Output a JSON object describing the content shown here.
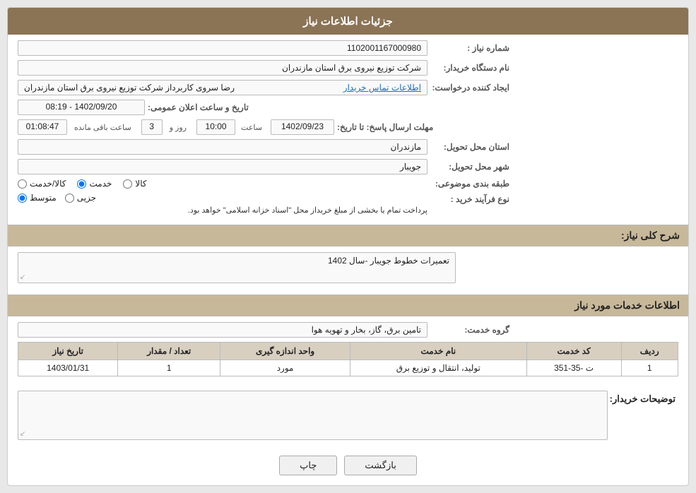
{
  "header": {
    "title": "جزئیات اطلاعات نیاز"
  },
  "fields": {
    "need_number_label": "شماره نیاز :",
    "need_number_value": "1102001167000980",
    "buyer_org_label": "نام دستگاه خریدار:",
    "buyer_org_value": "شرکت توزیع نیروی برق استان مازندران",
    "requester_label": "ایجاد کننده درخواست:",
    "requester_value": "رضا سروی کاربرداز شرکت توزیع نیروی برق استان مازندران",
    "contact_link": "اطلاعات تماس خریدار",
    "announce_label": "تاریخ و ساعت اعلان عمومی:",
    "announce_value": "1402/09/20 - 08:19",
    "deadline_label": "مهلت ارسال پاسخ: تا تاریخ:",
    "deadline_date": "1402/09/23",
    "deadline_time_label": "ساعت",
    "deadline_time_value": "10:00",
    "deadline_days_label": "روز و",
    "deadline_days_value": "3",
    "deadline_remain_label": "ساعت باقی مانده",
    "deadline_remain_value": "01:08:47",
    "delivery_province_label": "استان محل تحویل:",
    "delivery_province_value": "مازندران",
    "delivery_city_label": "شهر محل تحویل:",
    "delivery_city_value": "جویبار",
    "category_label": "طبقه بندی موضوعی:",
    "category_options": [
      "کالا",
      "خدمت",
      "کالا/خدمت"
    ],
    "category_selected": "خدمت",
    "process_label": "نوع فرآیند خرید :",
    "process_options": [
      "جزیی",
      "متوسط"
    ],
    "process_selected": "متوسط",
    "process_desc": "پرداخت تمام یا بخشی از مبلغ خریداز محل \"اسناد خزانه اسلامی\" خواهد بود.",
    "need_desc_label": "شرح کلی نیاز:",
    "need_desc_value": "تعمیرات خطوط جویبار -سال 1402",
    "services_section_label": "اطلاعات خدمات مورد نیاز",
    "group_service_label": "گروه خدمت:",
    "group_service_value": "تامین برق، گاز، بخار و تهویه هوا",
    "table": {
      "headers": [
        "ردیف",
        "کد خدمت",
        "نام خدمت",
        "واحد اندازه گیری",
        "تعداد / مقدار",
        "تاریخ نیاز"
      ],
      "rows": [
        {
          "row": "1",
          "code": "ت -35-351",
          "name": "تولید، انتقال و توزیع برق",
          "unit": "مورد",
          "qty": "1",
          "date": "1403/01/31"
        }
      ]
    },
    "buyer_desc_label": "توضیحات خریدار:",
    "buyer_desc_value": ""
  },
  "buttons": {
    "print_label": "چاپ",
    "back_label": "بازگشت"
  }
}
